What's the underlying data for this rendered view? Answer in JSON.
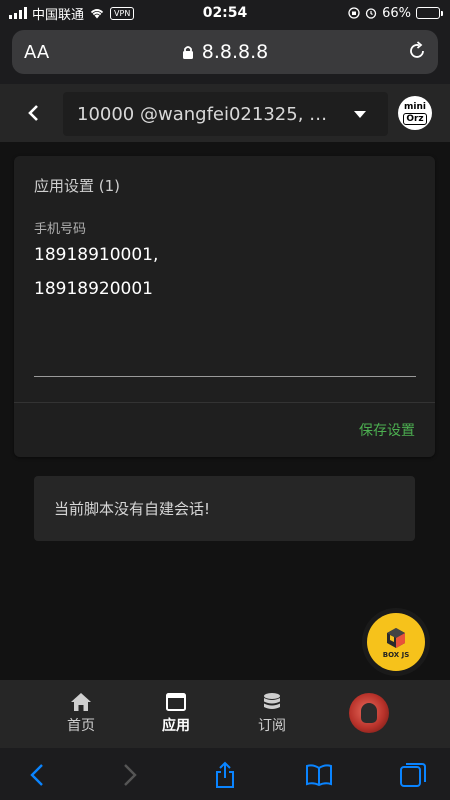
{
  "status_bar": {
    "carrier": "中国联通",
    "vpn": "VPN",
    "time": "02:54",
    "battery": "66%",
    "battery_level": 0.66
  },
  "safari": {
    "text_size_label": "AA",
    "url": "8.8.8.8"
  },
  "header": {
    "session_selector": "10000 @wangfei021325, @c...",
    "logo_line1": "mini",
    "logo_line2": "Orz"
  },
  "settings": {
    "title": "应用设置 (1)",
    "field_label": "手机号码",
    "field_value_line1": "18918910001,",
    "field_value_line2": "18918920001",
    "save_label": "保存设置"
  },
  "notice": "当前脚本没有自建会话!",
  "fab_label": "BOX JS",
  "nav": {
    "items": [
      {
        "label": "首页",
        "icon": "home-icon"
      },
      {
        "label": "应用",
        "icon": "window-icon"
      },
      {
        "label": "订阅",
        "icon": "database-icon"
      }
    ]
  },
  "colors": {
    "accent_green": "#4caf50",
    "fab_yellow": "#f6c21b",
    "ios_blue": "#0a84ff"
  }
}
